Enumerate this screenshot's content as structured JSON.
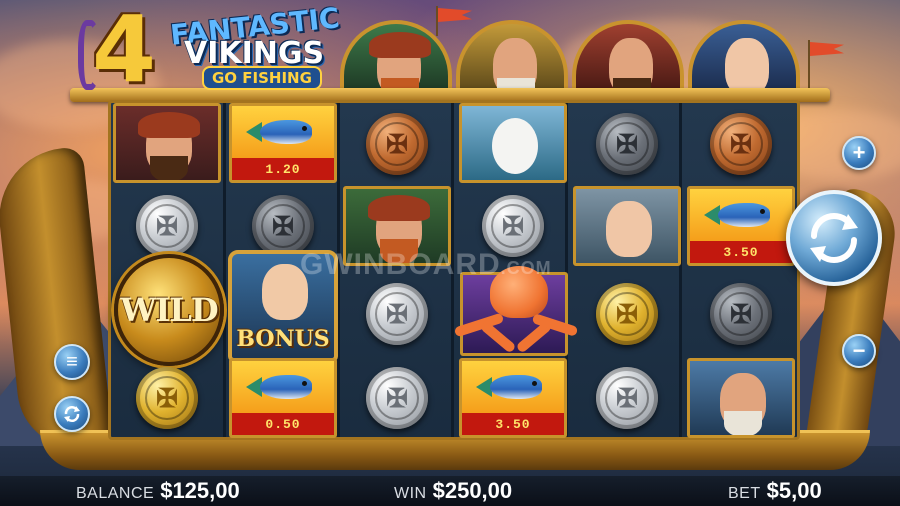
{
  "game": {
    "logo_number": "4",
    "logo_line1": "FANTASTIC",
    "logo_line2": "VIKINGS",
    "logo_line3": "GO FISHING"
  },
  "watermark": {
    "text": "GWINBOARD",
    "suffix": ".COM"
  },
  "symbols": {
    "wild_label": "WILD",
    "bonus_label": "BONUS",
    "fish_values": [
      "1.20",
      "3.50",
      "0.50",
      "3.50"
    ]
  },
  "controls": {
    "zoom_in": "+",
    "zoom_out": "−",
    "menu": "≡",
    "spin_icon": "spin-arrows-icon",
    "autoplay_icon": "autoplay-icon"
  },
  "footer": {
    "balance_label": "BALANCE",
    "balance_value": "$125,00",
    "win_label": "WIN",
    "win_value": "$250,00",
    "bet_label": "BET",
    "bet_value": "$5,00"
  },
  "colors": {
    "accent_gold": "#c9932e",
    "value_bar": "#c2180e",
    "button_blue": "#3a7cbd"
  }
}
